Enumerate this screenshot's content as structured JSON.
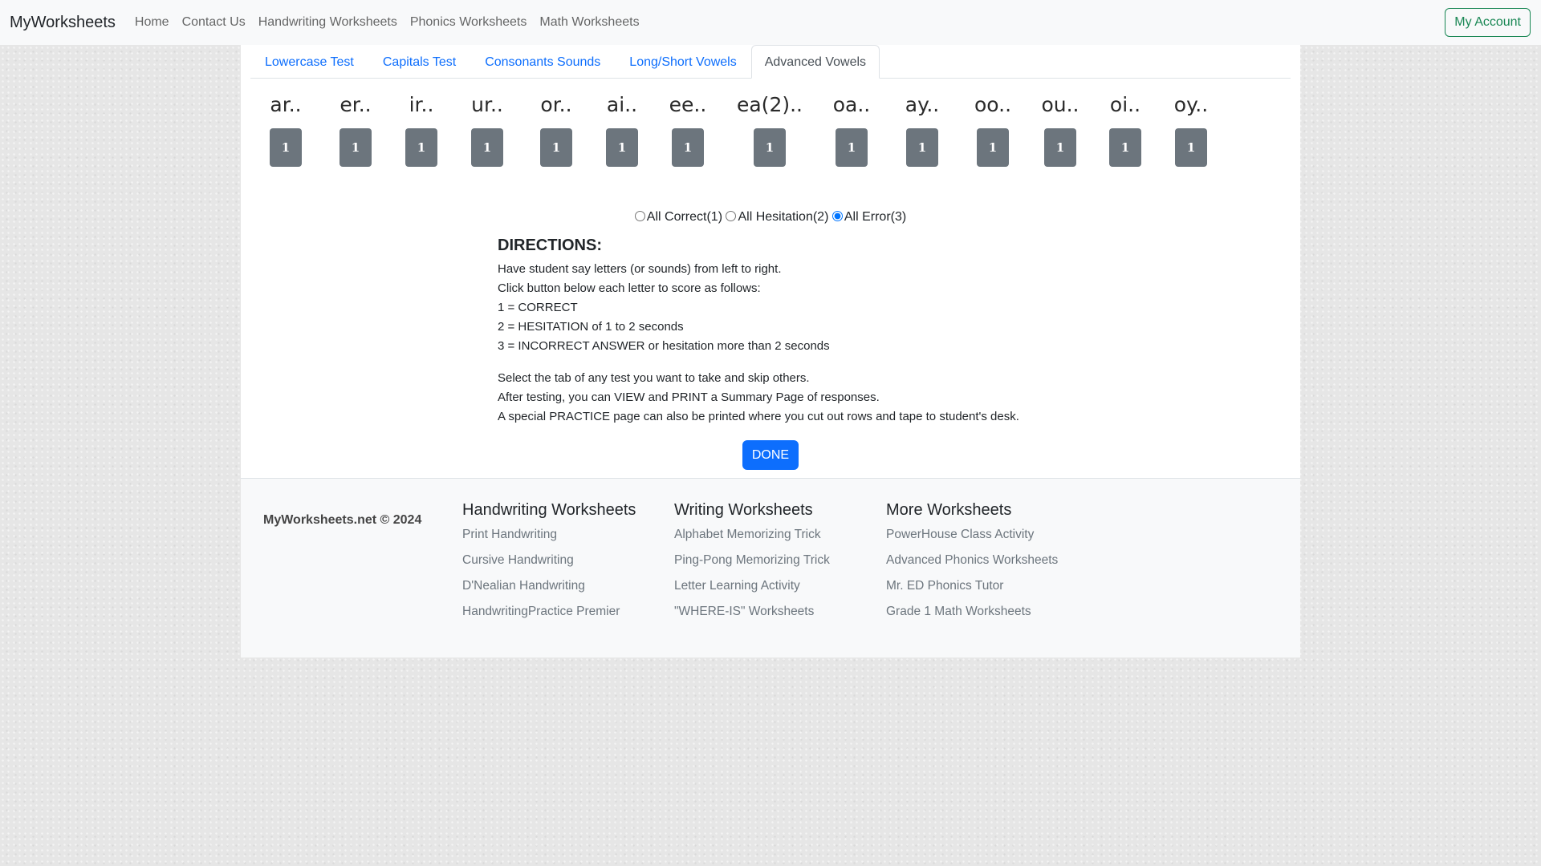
{
  "navbar": {
    "brand": "MyWorksheets",
    "links": [
      "Home",
      "Contact Us",
      "Handwriting Worksheets",
      "Phonics Worksheets",
      "Math Worksheets"
    ],
    "account_label": "My Account"
  },
  "tabs": [
    "Lowercase Test",
    "Capitals Test",
    "Consonants Sounds",
    "Long/Short Vowels",
    "Advanced Vowels"
  ],
  "active_tab": "Advanced Vowels",
  "letters": [
    {
      "label": "ar..",
      "score": "1"
    },
    {
      "label": "er..",
      "score": "1"
    },
    {
      "label": "ir..",
      "score": "1"
    },
    {
      "label": "ur..",
      "score": "1"
    },
    {
      "label": "or..",
      "score": "1"
    },
    {
      "label": "ai..",
      "score": "1"
    },
    {
      "label": "ee..",
      "score": "1"
    },
    {
      "label": "ea(2)..",
      "score": "1"
    },
    {
      "label": "oa..",
      "score": "1"
    },
    {
      "label": "ay..",
      "score": "1"
    },
    {
      "label": "oo..",
      "score": "1"
    },
    {
      "label": "ou..",
      "score": "1"
    },
    {
      "label": "oi..",
      "score": "1"
    },
    {
      "label": "oy..",
      "score": "1"
    }
  ],
  "radio": {
    "options": [
      "All Correct(1)",
      "All Hesitation(2)",
      "All Error(3)"
    ],
    "selected": "All Error(3)"
  },
  "directions": {
    "title": "DIRECTIONS:",
    "lines": [
      "Have student say letters (or sounds) from left to right.",
      "Click button below each letter to score as follows:",
      "1 = CORRECT",
      "2 = HESITATION of 1 to 2 seconds",
      "3 = INCORRECT ANSWER or hesitation more than 2 seconds"
    ],
    "lines2": [
      "Select the tab of any test you want to take and skip others.",
      "After testing, you can VIEW and PRINT a Summary Page of responses.",
      "A special PRACTICE page can also be printed where you cut out rows and tape to student's desk."
    ]
  },
  "done_label": "DONE",
  "footer": {
    "copyright": "MyWorksheets.net © 2024",
    "columns": [
      {
        "title": "Handwriting Worksheets",
        "links": [
          "Print Handwriting",
          "Cursive Handwriting",
          "D'Nealian Handwriting",
          "HandwritingPractice Premier"
        ]
      },
      {
        "title": "Writing Worksheets",
        "links": [
          "Alphabet Memorizing Trick",
          "Ping-Pong Memorizing Trick",
          "Letter Learning Activity",
          "\"WHERE-IS\" Worksheets"
        ]
      },
      {
        "title": "More Worksheets",
        "links": [
          "PowerHouse Class Activity",
          "Advanced Phonics Worksheets",
          "Mr. ED Phonics Tutor",
          "Grade 1 Math Worksheets"
        ]
      }
    ]
  },
  "colors": {
    "primary": "#0d6efd",
    "secondary": "#6c757d",
    "success": "#198754",
    "navbar_bg": "#f8f9fa"
  }
}
